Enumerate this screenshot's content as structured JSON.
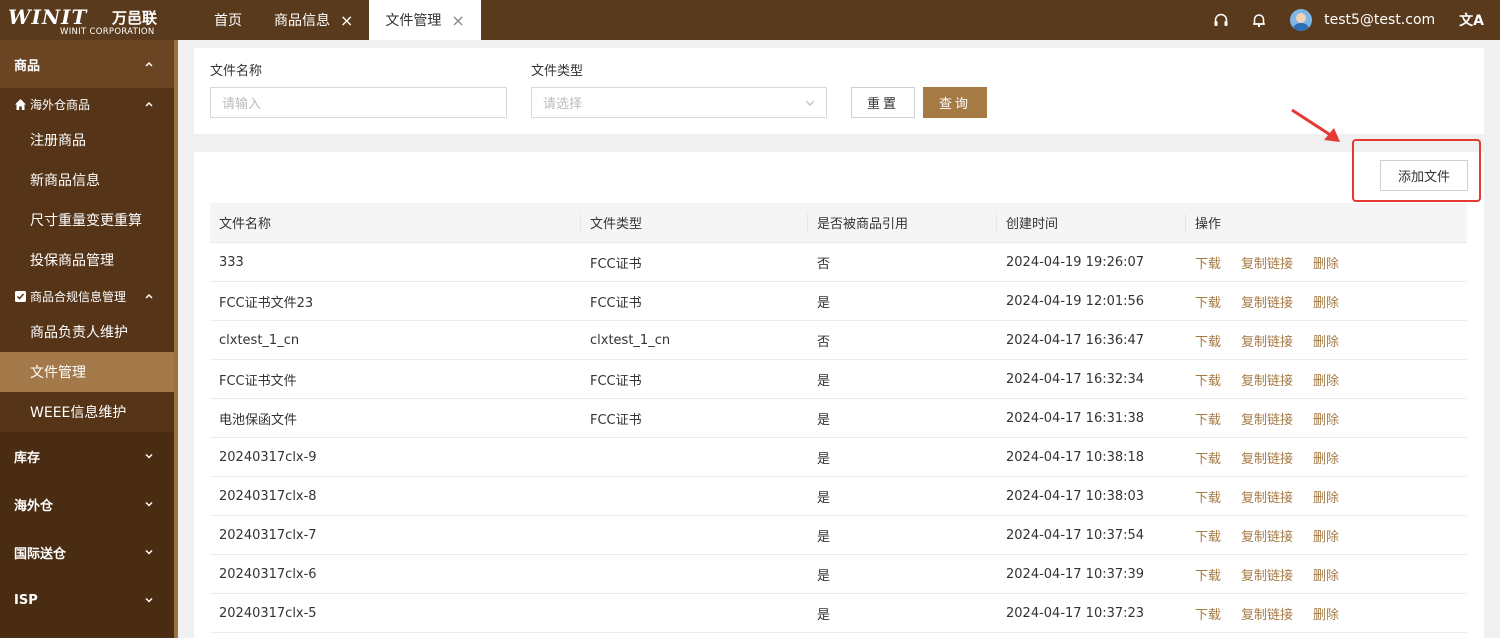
{
  "brand": {
    "logo_big": "WINIT",
    "logo_cn": "万邑联",
    "logo_small": "WINIT CORPORATION"
  },
  "tabs": [
    {
      "label": "首页",
      "closable": false,
      "active": false
    },
    {
      "label": "商品信息",
      "closable": true,
      "active": false
    },
    {
      "label": "文件管理",
      "closable": true,
      "active": true
    }
  ],
  "header": {
    "icons": [
      "headset-icon",
      "bell-icon"
    ],
    "user": "test5@test.com",
    "lang_icon": "translate-icon"
  },
  "sidebar": {
    "product_group": "商品",
    "overseas_sub": "海外仓商品",
    "overseas_items": [
      "注册商品",
      "新商品信息",
      "尺寸重量变更重算",
      "投保商品管理"
    ],
    "compliance_sub": "商品合规信息管理",
    "compliance_items": [
      "商品负责人维护",
      "文件管理",
      "WEEE信息维护"
    ],
    "active_item": "文件管理",
    "other_groups": [
      "库存",
      "海外仓",
      "国际送仓",
      "ISP"
    ]
  },
  "filter": {
    "name_label": "文件名称",
    "name_placeholder": "请输入",
    "type_label": "文件类型",
    "type_placeholder": "请选择",
    "reset": "重置",
    "query": "查询"
  },
  "add_button": "添加文件",
  "table": {
    "headers": [
      "文件名称",
      "文件类型",
      "是否被商品引用",
      "创建时间",
      "操作"
    ],
    "actions": [
      "下载",
      "复制链接",
      "删除"
    ],
    "rows": [
      {
        "name": "333",
        "type": "FCC证书",
        "referenced": "否",
        "created": "2024-04-19 19:26:07"
      },
      {
        "name": "FCC证书文件23",
        "type": "FCC证书",
        "referenced": "是",
        "created": "2024-04-19 12:01:56"
      },
      {
        "name": "clxtest_1_cn",
        "type": "clxtest_1_cn",
        "referenced": "否",
        "created": "2024-04-17 16:36:47"
      },
      {
        "name": "FCC证书文件",
        "type": "FCC证书",
        "referenced": "是",
        "created": "2024-04-17 16:32:34"
      },
      {
        "name": "电池保函文件",
        "type": "FCC证书",
        "referenced": "是",
        "created": "2024-04-17 16:31:38"
      },
      {
        "name": "20240317clx-9",
        "type": "",
        "referenced": "是",
        "created": "2024-04-17 10:38:18"
      },
      {
        "name": "20240317clx-8",
        "type": "",
        "referenced": "是",
        "created": "2024-04-17 10:38:03"
      },
      {
        "name": "20240317clx-7",
        "type": "",
        "referenced": "是",
        "created": "2024-04-17 10:37:54"
      },
      {
        "name": "20240317clx-6",
        "type": "",
        "referenced": "是",
        "created": "2024-04-17 10:37:39"
      },
      {
        "name": "20240317clx-5",
        "type": "",
        "referenced": "是",
        "created": "2024-04-17 10:37:23"
      }
    ]
  },
  "colors": {
    "topbar": "#5a3a1c",
    "sidebar": "#4a2c12",
    "accent": "#a57a45",
    "highlight": "#e53935"
  }
}
